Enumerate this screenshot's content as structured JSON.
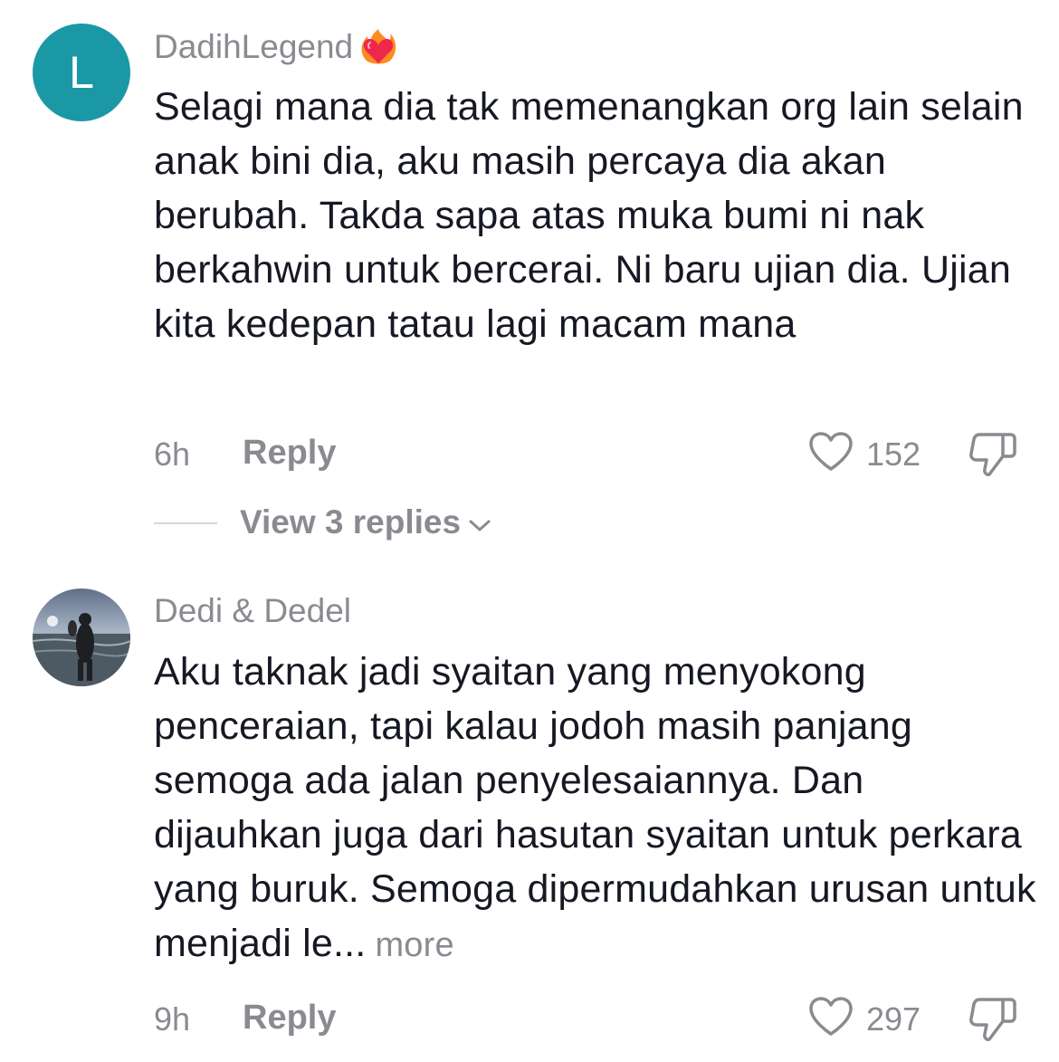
{
  "comments": [
    {
      "avatar_letter": "L",
      "avatar_color": "#1b98a6",
      "username": "DadihLegend",
      "username_badge": "heart-on-fire-icon",
      "text": "Selagi mana dia tak memenangkan org lain selain anak bini dia, aku masih percaya dia akan berubah. Takda sapa atas muka bumi ni nak berkahwin untuk bercerai. Ni baru ujian dia. Ujian kita kedepan tatau lagi macam mana",
      "time": "6h",
      "reply_label": "Reply",
      "likes": "152",
      "view_replies_label": "View 3 replies"
    },
    {
      "avatar_image": "beach-photo-avatar",
      "username": "Dedi & Dedel",
      "text": "Aku taknak jadi syaitan yang menyokong penceraian, tapi kalau jodoh masih panjang semoga ada jalan penyelesaiannya. Dan dijauhkan juga dari hasutan syaitan untuk perkara yang buruk. Semoga dipermudahkan urusan untuk menjadi le...",
      "more_label": "more",
      "time": "9h",
      "reply_label": "Reply",
      "likes": "297"
    }
  ],
  "colors": {
    "primary_text": "#161823",
    "secondary_text": "#8a8b91",
    "divider": "#d6d7da"
  }
}
